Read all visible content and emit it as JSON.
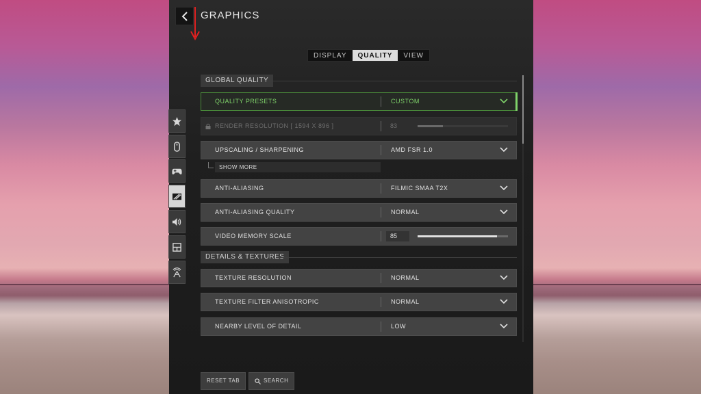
{
  "header": {
    "title": "GRAPHICS"
  },
  "tabs": [
    {
      "label": "DISPLAY",
      "active": false
    },
    {
      "label": "QUALITY",
      "active": true
    },
    {
      "label": "VIEW",
      "active": false
    }
  ],
  "sidebar_icons": [
    "star-icon",
    "mouse-icon",
    "controller-icon",
    "graphics-icon",
    "speaker-icon",
    "interface-icon",
    "network-icon"
  ],
  "sections": {
    "global_quality": "GLOBAL QUALITY",
    "details_textures": "DETAILS & TEXTURES"
  },
  "settings": {
    "quality_presets": {
      "label": "QUALITY PRESETS",
      "value": "CUSTOM"
    },
    "render_resolution": {
      "label": "RENDER RESOLUTION [ 1594 X 896 ]",
      "value": "83",
      "fill": 0.28
    },
    "upscaling": {
      "label": "UPSCALING / SHARPENING",
      "value": "AMD FSR 1.0"
    },
    "show_more": "SHOW MORE",
    "anti_aliasing": {
      "label": "ANTI-ALIASING",
      "value": "FILMIC SMAA T2X"
    },
    "aa_quality": {
      "label": "ANTI-ALIASING QUALITY",
      "value": "NORMAL"
    },
    "video_memory": {
      "label": "VIDEO MEMORY SCALE",
      "value": "85",
      "fill": 0.88
    },
    "texture_resolution": {
      "label": "TEXTURE RESOLUTION",
      "value": "NORMAL"
    },
    "texture_filter": {
      "label": "TEXTURE FILTER ANISOTROPIC",
      "value": "NORMAL"
    },
    "nearby_lod": {
      "label": "NEARBY LEVEL OF DETAIL",
      "value": "LOW"
    }
  },
  "footer": {
    "reset_label": "RESET TAB",
    "search_label": "SEARCH"
  },
  "colors": {
    "accent_green": "#7fd36a",
    "annotation_red": "#e02020"
  }
}
